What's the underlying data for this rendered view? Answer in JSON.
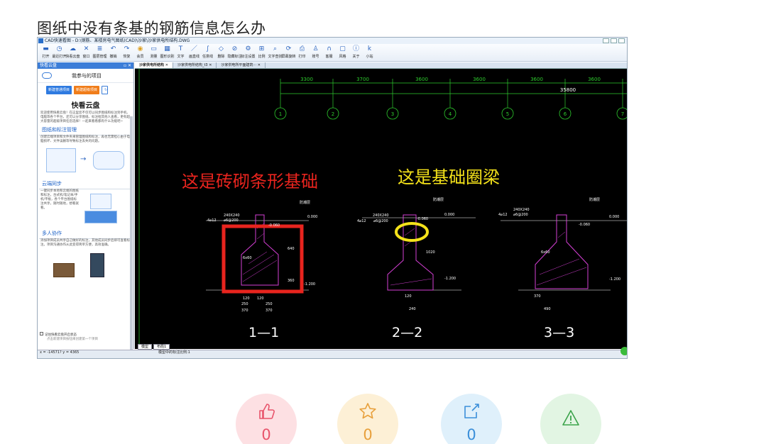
{
  "article": {
    "title": "图纸中没有条基的钢筋信息怎么办"
  },
  "app": {
    "window_title": "CAD快速看图 - D:\\钢筋、某楼房电气图纸(CAD)\\沙家\\沙家供电所结构.DWG",
    "toolbar": [
      "打开",
      "最近打开",
      "快看云盘",
      "窗口",
      "图层管理",
      "撤销",
      "恢复",
      "会员",
      "测量",
      "图形识别",
      "文字",
      "画直线",
      "任意线",
      "删除",
      "隐藏标注",
      "标注设置",
      "比例",
      "文字查找",
      "屏幕旋转",
      "打印",
      "账号",
      "客服",
      "风格",
      "关于",
      "小站"
    ],
    "toolbar_icons": [
      "folder-icon",
      "clock-icon",
      "cloud-icon",
      "window-icon",
      "layers-icon",
      "undo-icon",
      "redo-icon",
      "vip-icon",
      "measure-icon",
      "image-icon",
      "text-icon",
      "line-icon",
      "curve-icon",
      "eraser-icon",
      "hide-icon",
      "settings-icon",
      "scale-icon",
      "search-icon",
      "rotate-icon",
      "print-icon",
      "user-icon",
      "headset-icon",
      "style-icon",
      "info-icon",
      "k-icon"
    ]
  },
  "sidebar": {
    "header": "快看云盘",
    "ctl": "▫ ✕",
    "my_projects": "我参与的项目",
    "new_normal": "新建普通项目",
    "new_advanced": "新建超级项目",
    "refresh": "↻",
    "brand": "快看云盘",
    "intro": "欢迎使用快看云盘！在这里您不仅可以同步图纸和标注到手机、电脑等各个平台，还可以分享图纸、标注给其他人查看，更有超大容量的超级项目任您选择！一起来看看都有什么功能吧~",
    "sec1_title": "图纸和标注管理",
    "sec1_text": "创建云端项目和文件夹来管理图纸和标注，再也无需担心由于电脑损坏、文件误删等导致标注丢失的问题。",
    "sec2_title": "云端同步",
    "sec2_text": "一键同步本地和云端的图纸和标注，台式机/笔记本/手机/平板，各个平台图纸标注共享，随时随地，想看就看。",
    "sec3_title": "多人协作",
    "sec3_text": "添加项目成员共享自己做好的标注，其他成员同步后即可查看标注。项目沟通协作从此变得简单方便，高效准确。",
    "remember": "记住快看云盘开启状态",
    "hint": "点击新建项目按钮来创建第一个项目",
    "coords": "x = -14571? y = 4365"
  },
  "tabs": [
    "沙家供电所结构",
    "沙家供电所结构_t3",
    "沙家供电所平面建筑···"
  ],
  "cad": {
    "dims": [
      "3300",
      "3700",
      "3600",
      "3600",
      "3600",
      "3600"
    ],
    "total": "35800",
    "axes": [
      "1",
      "2",
      "3",
      "4",
      "5",
      "6",
      "7"
    ],
    "note1": "这是砖砌条形基础",
    "note2": "这是基础圈梁",
    "section1": "1—1",
    "section2": "2—2",
    "section3": "3—3",
    "floor": "防潮层",
    "lvl0": "0.000",
    "lvl1": "-0.060",
    "lvl2": "-1.200",
    "beam": "240X240",
    "rebar1": "4⌀12",
    "rebar2": "⌀6@200",
    "d250": "250",
    "d370": "370",
    "d120": "120",
    "d490": "490",
    "d240": "240",
    "d640": "640",
    "d1020": "1020",
    "d360": "360",
    "d6x60": "6x60"
  },
  "bottom_tabs": [
    "模型",
    "布局1"
  ],
  "status_mid": "模型中的标注比例:1",
  "actions": {
    "like": "0",
    "favorite": "0",
    "share": "0"
  },
  "colors": {
    "note_red": "#e8241e",
    "note_yellow": "#f4e21a",
    "grid": "#2ecc2e",
    "wall": "#d43fd4"
  }
}
